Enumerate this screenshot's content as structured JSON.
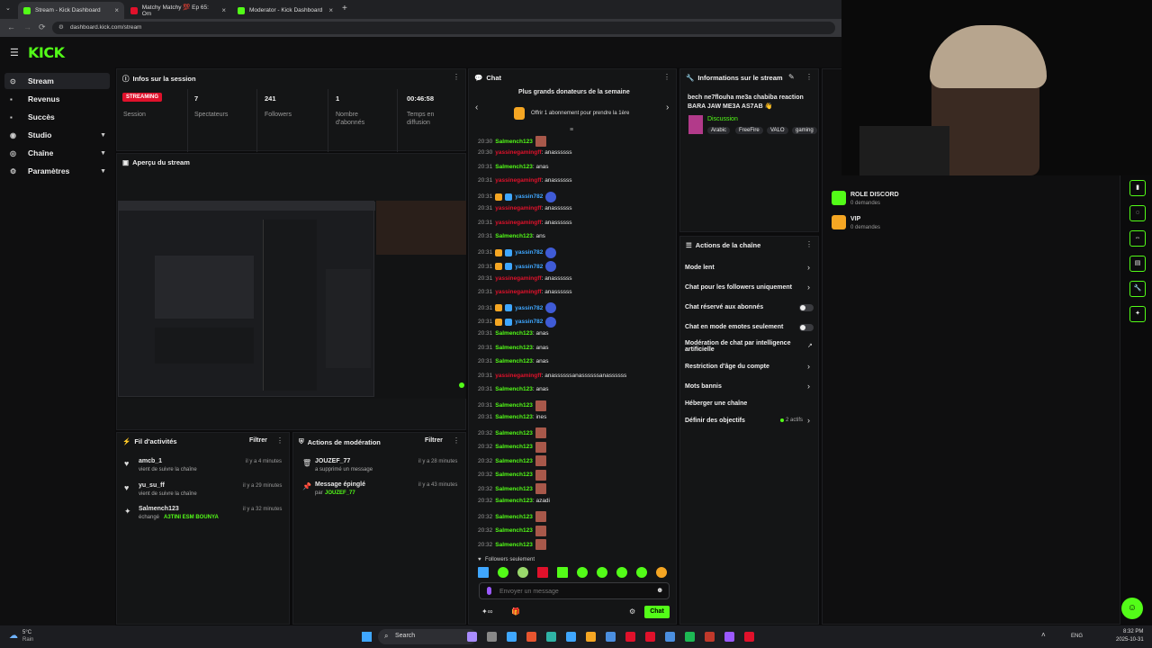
{
  "browser": {
    "tabs": [
      {
        "label": "Stream - Kick Dashboard",
        "color": "#53fc18"
      },
      {
        "label": "Matchy Matchy 💯 Ep 65: Om",
        "color": "#e0112b"
      },
      {
        "label": "Moderator - Kick Dashboard",
        "color": "#53fc18"
      }
    ],
    "new_tab": "+",
    "url": "dashboard.kick.com/stream"
  },
  "brand": {
    "logo": "KICK",
    "accent": "#53fc18"
  },
  "sidebar": {
    "items": [
      {
        "label": "Stream",
        "icon": "circle-icon"
      },
      {
        "label": "Revenus",
        "icon": "money-icon"
      },
      {
        "label": "Succès",
        "icon": "trophy-icon"
      },
      {
        "label": "Studio",
        "icon": "studio-icon"
      },
      {
        "label": "Chaîne",
        "icon": "channel-icon"
      },
      {
        "label": "Paramètres",
        "icon": "gear-icon"
      }
    ]
  },
  "session": {
    "title": "Infos sur la session",
    "status": "STREAMING",
    "status_label": "Session",
    "stats": [
      {
        "value": "7",
        "label": "Spectateurs"
      },
      {
        "value": "241",
        "label": "Followers"
      },
      {
        "value": "1",
        "label": "Nombre d'abonnés"
      },
      {
        "value": "00:46:58",
        "label": "Temps en diffusion"
      }
    ]
  },
  "preview": {
    "title": "Aperçu du stream"
  },
  "activity": {
    "title": "Fil d'activités",
    "filter": "Filtrer",
    "items": [
      {
        "user": "amcb_1",
        "desc": "vient de suivre la chaîne",
        "time": "il y a 4 minutes"
      },
      {
        "user": "yu_su_ff",
        "desc": "vient de suivre la chaîne",
        "time": "il y a 29 minutes"
      },
      {
        "user": "Salmench123",
        "desc": "échangé",
        "highlight": "A3TINI ESM BOUNYA",
        "time": "il y a 32 minutes"
      }
    ]
  },
  "moderation": {
    "title": "Actions de modération",
    "filter": "Filtrer",
    "items": [
      {
        "user": "JOUZEF_77",
        "desc": "a supprimé un message",
        "time": "il y a 28 minutes"
      },
      {
        "user": "Message épinglé",
        "desc": "par",
        "highlight": "JOUZEF_77",
        "time": "il y a 43 minutes"
      }
    ]
  },
  "chat": {
    "title": "Chat",
    "banner_title": "Plus grands donateurs de la semaine",
    "banner_sub": "Offrir 1 abonnement pour prendre la 1ère",
    "messages": [
      {
        "time": "20:30",
        "user": "Salmench123",
        "color": "g",
        "text": "",
        "emote": true
      },
      {
        "time": "20:30",
        "user": "yassinegamingff",
        "color": "r",
        "text": ": anassssss"
      },
      {
        "time": "20:31",
        "user": "Salmench123",
        "color": "g",
        "text": ": anas"
      },
      {
        "time": "20:31",
        "user": "yassinegamingff",
        "color": "r",
        "text": ": anassssss"
      },
      {
        "time": "20:31",
        "user": "yassin782",
        "color": "b",
        "text": "",
        "badges": true
      },
      {
        "time": "20:31",
        "user": "yassinegamingff",
        "color": "r",
        "text": ": anassssss"
      },
      {
        "time": "20:31",
        "user": "yassinegamingff",
        "color": "r",
        "text": ": anassssss"
      },
      {
        "time": "20:31",
        "user": "Salmench123",
        "color": "g",
        "text": ": ans"
      },
      {
        "time": "20:31",
        "user": "yassin782",
        "color": "b",
        "text": "",
        "badges": true
      },
      {
        "time": "20:31",
        "user": "yassin782",
        "color": "b",
        "text": "",
        "badges": true
      },
      {
        "time": "20:31",
        "user": "yassinegamingff",
        "color": "r",
        "text": ": anassssss"
      },
      {
        "time": "20:31",
        "user": "yassinegamingff",
        "color": "r",
        "text": ": anassssss"
      },
      {
        "time": "20:31",
        "user": "yassin782",
        "color": "b",
        "text": "",
        "badges": true
      },
      {
        "time": "20:31",
        "user": "yassin782",
        "color": "b",
        "text": "",
        "badges": true
      },
      {
        "time": "20:31",
        "user": "Salmench123",
        "color": "g",
        "text": ": anas"
      },
      {
        "time": "20:31",
        "user": "Salmench123",
        "color": "g",
        "text": ": anas"
      },
      {
        "time": "20:31",
        "user": "Salmench123",
        "color": "g",
        "text": ": anas"
      },
      {
        "time": "20:31",
        "user": "yassinegamingff",
        "color": "r",
        "text": ": anassssssanassssssanassssss"
      },
      {
        "time": "20:31",
        "user": "Salmench123",
        "color": "g",
        "text": ": anas"
      },
      {
        "time": "20:31",
        "user": "Salmench123",
        "color": "g",
        "text": "",
        "emote": true
      },
      {
        "time": "20:31",
        "user": "Salmench123",
        "color": "g",
        "text": ": ines"
      },
      {
        "time": "20:32",
        "user": "Salmench123",
        "color": "g",
        "text": "",
        "emote": true
      },
      {
        "time": "20:32",
        "user": "Salmench123",
        "color": "g",
        "text": "",
        "emote": true
      },
      {
        "time": "20:32",
        "user": "Salmench123",
        "color": "g",
        "text": "",
        "emote": true
      },
      {
        "time": "20:32",
        "user": "Salmench123",
        "color": "g",
        "text": "",
        "emote": true
      },
      {
        "time": "20:32",
        "user": "Salmench123",
        "color": "g",
        "text": "",
        "emote": true
      },
      {
        "time": "20:32",
        "user": "Salmench123",
        "color": "g",
        "text": ": azadi"
      },
      {
        "time": "20:32",
        "user": "Salmench123",
        "color": "g",
        "text": "",
        "emote": true
      },
      {
        "time": "20:32",
        "user": "Salmench123",
        "color": "g",
        "text": "",
        "emote": true
      },
      {
        "time": "20:32",
        "user": "Salmench123",
        "color": "g",
        "text": "",
        "emote": true
      }
    ],
    "followers_only": "Followers seulement",
    "input_placeholder": "Envoyer un message",
    "send_label": "Chat"
  },
  "stream_info": {
    "title": "Informations sur le stream",
    "stream_title": "bech ne7flouha me3a chabiba reaction BARA JAW ME3A AS7AB 👋",
    "category": "Discussion",
    "tags": [
      "Arabic",
      "FreeFire",
      "VALO",
      "gaming"
    ]
  },
  "channel_actions": {
    "title": "Actions de la chaîne",
    "items": [
      {
        "label": "Mode lent",
        "kind": "arrow"
      },
      {
        "label": "Chat pour les followers uniquement",
        "kind": "arrow"
      },
      {
        "label": "Chat réservé aux abonnés",
        "kind": "toggle"
      },
      {
        "label": "Chat en mode emotes seulement",
        "kind": "toggle"
      },
      {
        "label": "Modération de chat par intelligence artificielle",
        "kind": "external"
      },
      {
        "label": "Restriction d'âge du compte",
        "kind": "arrow"
      },
      {
        "label": "Mots bannis",
        "kind": "arrow"
      },
      {
        "label": "Héberger une chaîne",
        "kind": "none"
      },
      {
        "label": "Définir des objectifs",
        "kind": "arrow",
        "extra": "2 actifs"
      }
    ]
  },
  "rewards": {
    "items": [
      {
        "label": "ROLE DISCORD",
        "sub": "0 demandes",
        "color": "#53fc18"
      },
      {
        "label": "VIP",
        "sub": "0 demandes",
        "color": "#f5a623"
      }
    ]
  },
  "taskbar": {
    "weather_temp": "5°C",
    "weather_desc": "Rain",
    "search": "Search",
    "lang": "ENG",
    "time": "8:32 PM",
    "date": "2025-10-31"
  }
}
